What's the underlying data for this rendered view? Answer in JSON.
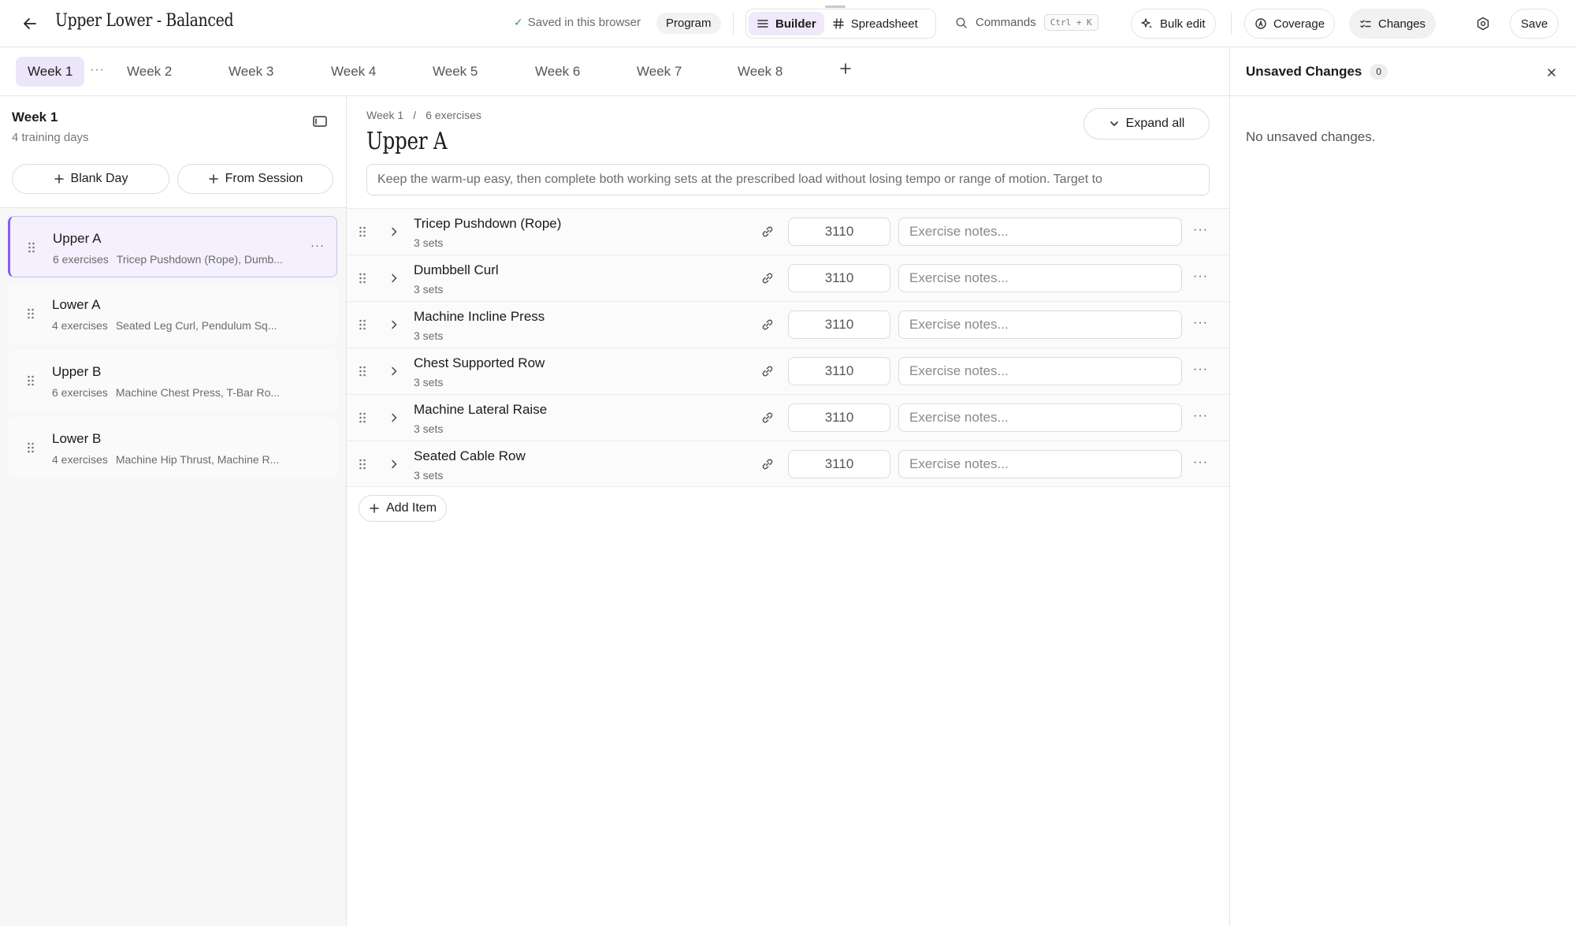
{
  "header": {
    "title": "Upper Lower - Balanced",
    "saved_status": "Saved in this browser",
    "program_label": "Program",
    "view_builder": "Builder",
    "view_spreadsheet": "Spreadsheet",
    "commands_label": "Commands",
    "commands_shortcut": "Ctrl + K",
    "bulk_edit": "Bulk edit",
    "coverage": "Coverage",
    "changes": "Changes",
    "save": "Save",
    "accent_color": "#8a5cf2"
  },
  "weeks": {
    "tabs": [
      "Week 1",
      "Week 2",
      "Week 3",
      "Week 4",
      "Week 5",
      "Week 6",
      "Week 7",
      "Week 8"
    ],
    "active": "Week 1",
    "more_label": "···"
  },
  "sidebar": {
    "week_title": "Week 1",
    "training_days": "4 training days",
    "blank_day": "Blank Day",
    "from_session": "From Session",
    "days": [
      {
        "name": "Upper A",
        "count": "6 exercises",
        "summary": "Tricep Pushdown (Rope), Dumb...",
        "active": true
      },
      {
        "name": "Lower A",
        "count": "4 exercises",
        "summary": "Seated Leg Curl, Pendulum Sq...",
        "active": false
      },
      {
        "name": "Upper B",
        "count": "6 exercises",
        "summary": "Machine Chest Press, T-Bar Ro...",
        "active": false
      },
      {
        "name": "Lower B",
        "count": "4 exercises",
        "summary": "Machine Hip Thrust, Machine R...",
        "active": false
      }
    ]
  },
  "main": {
    "breadcrumb_week": "Week 1",
    "breadcrumb_sep": "/",
    "breadcrumb_count": "6 exercises",
    "day_title": "Upper A",
    "expand_all": "Expand all",
    "day_notes": "Keep the warm-up easy, then complete both working sets at the prescribed load without losing tempo or range of motion. Target to",
    "notes_placeholder": "Exercise notes...",
    "add_item": "Add Item",
    "exercises": [
      {
        "name": "Tricep Pushdown (Rope)",
        "sets": "3 sets",
        "tempo": "3110"
      },
      {
        "name": "Dumbbell Curl",
        "sets": "3 sets",
        "tempo": "3110"
      },
      {
        "name": "Machine Incline Press",
        "sets": "3 sets",
        "tempo": "3110"
      },
      {
        "name": "Chest Supported Row",
        "sets": "3 sets",
        "tempo": "3110"
      },
      {
        "name": "Machine Lateral Raise",
        "sets": "3 sets",
        "tempo": "3110"
      },
      {
        "name": "Seated Cable Row",
        "sets": "3 sets",
        "tempo": "3110"
      }
    ]
  },
  "changes_panel": {
    "title": "Unsaved Changes",
    "count": "0",
    "empty_text": "No unsaved changes."
  }
}
